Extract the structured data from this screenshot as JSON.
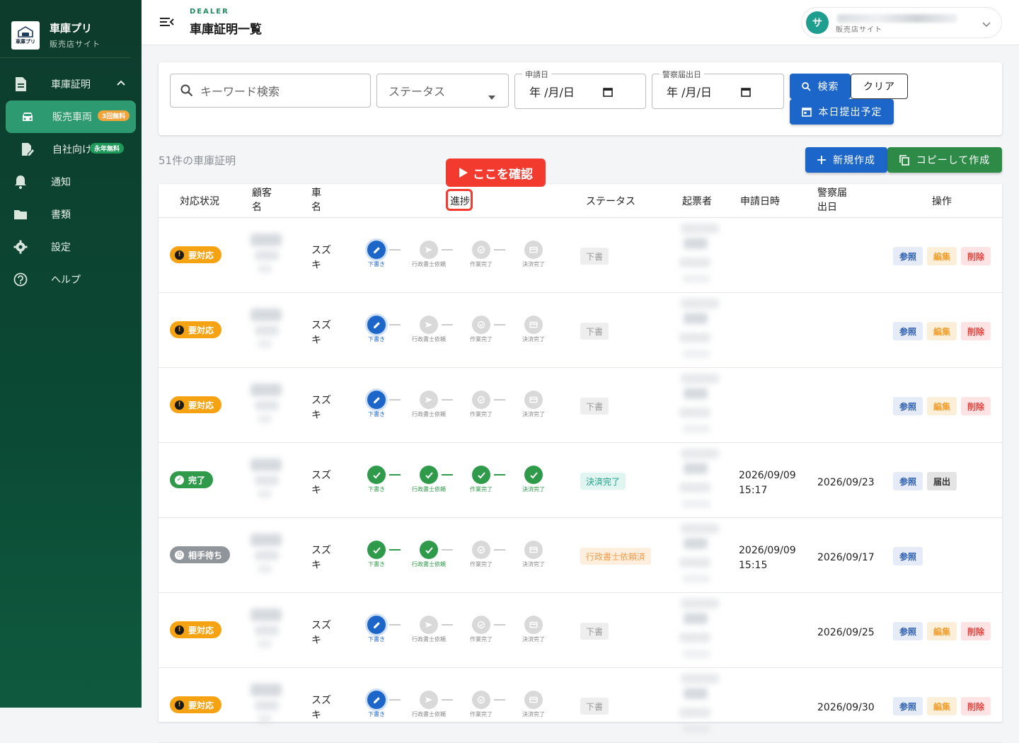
{
  "sidebar": {
    "brand_title": "車庫プリ",
    "brand_sub": "販売店サイト",
    "logo_text": "車庫プリ",
    "items": [
      {
        "label": "車庫証明"
      },
      {
        "label": "販売車両",
        "badge": "3回無料"
      },
      {
        "label": "自社向け",
        "badge": "永年無料"
      },
      {
        "label": "通知"
      },
      {
        "label": "書類"
      },
      {
        "label": "設定"
      },
      {
        "label": "ヘルプ"
      }
    ]
  },
  "header": {
    "subtitle": "DEALER",
    "title": "車庫証明一覧",
    "user_initial": "サ",
    "user_role": "販売店サイト"
  },
  "search": {
    "keyword_placeholder": "キーワード検索",
    "status_placeholder": "ステータス",
    "apply_date_label": "申請日",
    "apply_date_value": "年 /月/日",
    "police_date_label": "警察届出日",
    "police_date_value": "年 /月/日",
    "search_button": "検索",
    "clear_button": "クリア",
    "today_button": "本日提出予定"
  },
  "list": {
    "count_text": "51件の車庫証明",
    "new_button": "新規作成",
    "copy_button": "コピーして作成",
    "callout": "ここを確認"
  },
  "table": {
    "headers": [
      "対応状況",
      "顧客名",
      "車名",
      "進捗",
      "ステータス",
      "起票者",
      "申請日時",
      "警察届出日",
      "操作"
    ],
    "header_customer": [
      "顧客",
      "名"
    ],
    "header_car": [
      "車",
      "名"
    ],
    "header_police": [
      "警察届",
      "出日"
    ],
    "step_labels": [
      "下書き",
      "行政書士依頼",
      "作業完了",
      "決済完了"
    ],
    "rows": [
      {
        "chip": "要対応",
        "chip_type": "warn",
        "car": [
          "スズ",
          "キ"
        ],
        "progress": 1,
        "status": "下書",
        "status_type": "draft",
        "apply": [
          "",
          ""
        ],
        "police": "",
        "actions": [
          "参照",
          "編集",
          "削除"
        ]
      },
      {
        "chip": "要対応",
        "chip_type": "warn",
        "car": [
          "スズ",
          "キ"
        ],
        "progress": 1,
        "status": "下書",
        "status_type": "draft",
        "apply": [
          "",
          ""
        ],
        "police": "",
        "actions": [
          "参照",
          "編集",
          "削除"
        ]
      },
      {
        "chip": "要対応",
        "chip_type": "warn",
        "car": [
          "スズ",
          "キ"
        ],
        "progress": 1,
        "status": "下書",
        "status_type": "draft",
        "apply": [
          "",
          ""
        ],
        "police": "",
        "actions": [
          "参照",
          "編集",
          "削除"
        ]
      },
      {
        "chip": "完了",
        "chip_type": "done",
        "car": [
          "スズ",
          "キ"
        ],
        "progress": 4,
        "status": "決済完了",
        "status_type": "done",
        "apply": [
          "2026/09/09",
          "15:17"
        ],
        "police": "2026/09/23",
        "actions": [
          "参照",
          "届出"
        ]
      },
      {
        "chip": "相手待ち",
        "chip_type": "wait",
        "car": [
          "スズ",
          "キ"
        ],
        "progress": 2,
        "status": "行政書士依頼済",
        "status_type": "req",
        "apply": [
          "2026/09/09",
          "15:15"
        ],
        "police": "2026/09/17",
        "actions": [
          "参照"
        ]
      },
      {
        "chip": "要対応",
        "chip_type": "warn",
        "car": [
          "スズ",
          "キ"
        ],
        "progress": 1,
        "status": "下書",
        "status_type": "draft",
        "apply": [
          "",
          ""
        ],
        "police": "2026/09/25",
        "actions": [
          "参照",
          "編集",
          "削除"
        ]
      },
      {
        "chip": "要対応",
        "chip_type": "warn",
        "car": [
          "スズ",
          "キ"
        ],
        "progress": 1,
        "status": "下書",
        "status_type": "draft",
        "apply": [
          "",
          ""
        ],
        "police": "2026/09/30",
        "actions": [
          "参照",
          "編集",
          "削除"
        ]
      }
    ]
  }
}
